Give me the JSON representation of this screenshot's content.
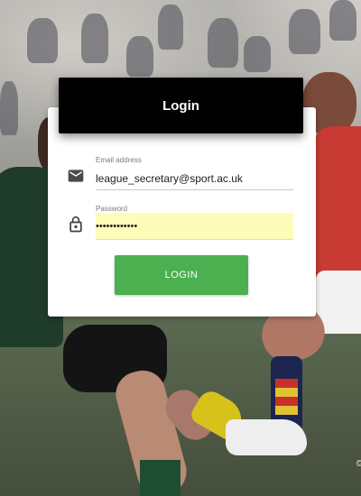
{
  "login": {
    "title": "Login",
    "email": {
      "label": "Email address",
      "value": "league_secretary@sport.ac.uk",
      "icon": "mail-icon"
    },
    "password": {
      "label": "Password",
      "value": "••••••••••••",
      "icon": "lock-icon"
    },
    "button_label": "LOGIN"
  },
  "background": {
    "description_icon": "rugby-photo",
    "copyright_mark": "©"
  },
  "colors": {
    "header_bg": "#000000",
    "button_bg": "#4caf50",
    "autofill_bg": "#fdfdb9",
    "card_bg": "#ffffff"
  }
}
